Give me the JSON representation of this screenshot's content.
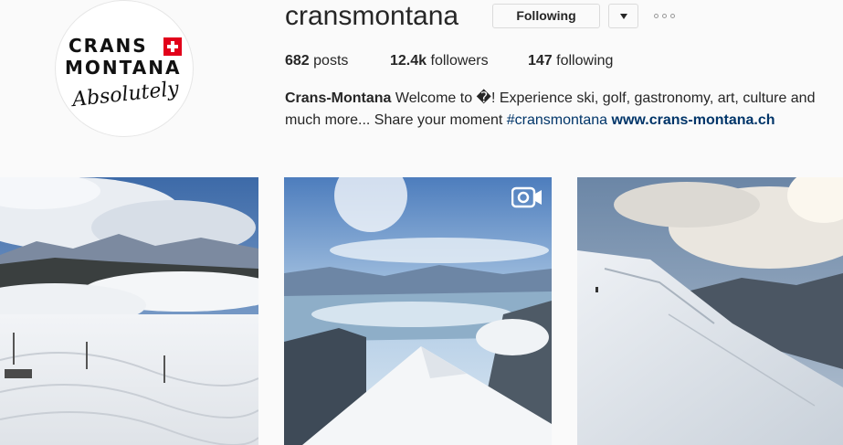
{
  "profile": {
    "username": "cransmontana",
    "avatar": {
      "logo_line1": "CRANS",
      "logo_line2": "MONTANA",
      "logo_script": "Absolutely"
    },
    "follow_button_label": "Following",
    "stats": {
      "posts_count": "682",
      "posts_label": "posts",
      "followers_count": "12.4k",
      "followers_label": "followers",
      "following_count": "147",
      "following_label": "following"
    },
    "bio": {
      "name": "Crans-Montana",
      "text": "Welcome to �! Experience ski, golf, gastronomy, art, culture and much more... Share your moment",
      "hashtag": "#cransmontana",
      "url": "www.crans-montana.ch"
    }
  },
  "icons": {
    "dropdown": "chevron-down-icon",
    "more": "more-options-icon",
    "video": "video-icon"
  },
  "colors": {
    "link": "#003569",
    "swiss_red": "#e2001a",
    "background": "#fafafa"
  },
  "posts": [
    {
      "kind": "photo",
      "description": "snowy ski slope with clouds"
    },
    {
      "kind": "video",
      "description": "valley view from mountain ridge"
    },
    {
      "kind": "photo",
      "description": "snowy mountain slope under cloudy sky"
    }
  ]
}
